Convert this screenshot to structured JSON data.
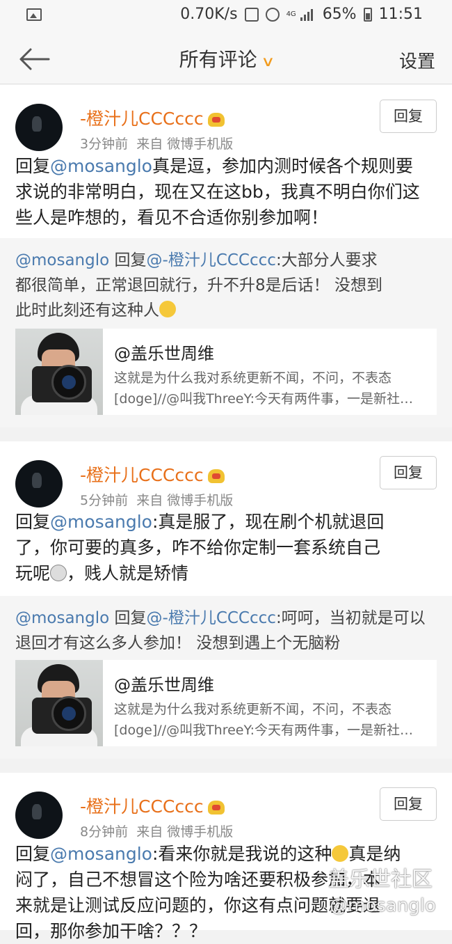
{
  "status_bar": {
    "speed": "0.70K/s",
    "network": "4G",
    "battery": "65%",
    "time": "11:51"
  },
  "nav": {
    "title": "所有评论",
    "settings": "设置"
  },
  "comments": [
    {
      "user": "-橙汁儿CCCccc",
      "time": "3分钟前",
      "source": "来自 微博手机版",
      "reply_label": "回复",
      "prefix": "回复",
      "mention": "@mosanglo",
      "lines": [
        "真是逗，参加内测时候各个规则要",
        "求说的非常明白，现在又在这bb，我真不明白你们这",
        "些人是咋想的，看见不合适你别参加啊！"
      ],
      "quote": {
        "author": "@mosanglo",
        "reply_word": " 回复",
        "target": "@-橙汁儿CCCccc",
        "lines": [
          ":大部分人要求",
          "都很简单，正常退回就行，升不升8是后话！ 没想到",
          "此时此刻还有这种人"
        ]
      },
      "link": {
        "title": "@盖乐世周维",
        "desc1": "这就是为什么我对系统更新不闻，不问，不表态",
        "desc2": "[doge]//@叫我ThreeY:今天有两件事，一是新社…"
      }
    },
    {
      "user": "-橙汁儿CCCccc",
      "time": "5分钟前",
      "source": "来自 微博手机版",
      "reply_label": "回复",
      "prefix": "回复",
      "mention": "@mosanglo",
      "lines": [
        ":真是服了，现在刷个机就退回",
        "了，你可要的真多，咋不给你定制一套系统自己",
        "玩呢"
      ],
      "line3_tail": "，贱人就是矫情",
      "quote": {
        "author": "@mosanglo",
        "reply_word": " 回复",
        "target": "@-橙汁儿CCCccc",
        "lines": [
          ":呵呵，当初就是可以",
          "退回才有这么多人参加！ 没想到遇上个无脑粉"
        ]
      },
      "link": {
        "title": "@盖乐世周维",
        "desc1": "这就是为什么我对系统更新不闻，不问，不表态",
        "desc2": "[doge]//@叫我ThreeY:今天有两件事，一是新社…"
      }
    },
    {
      "user": "-橙汁儿CCCccc",
      "time": "8分钟前",
      "source": "来自 微博手机版",
      "reply_label": "回复",
      "prefix": "回复",
      "mention": "@mosanglo",
      "line1_a": ":看来你就是我说的这种",
      "line1_b": "真是纳",
      "lines": [
        "闷了，自己不想冒这个险为啥还要积极参加，本",
        "来就是让测试反应问题的，你这有点问题就要退",
        "回，那你参加干啥？？？"
      ]
    }
  ],
  "watermark": {
    "community": "盖乐世社区",
    "handle": "@mosanglo"
  }
}
